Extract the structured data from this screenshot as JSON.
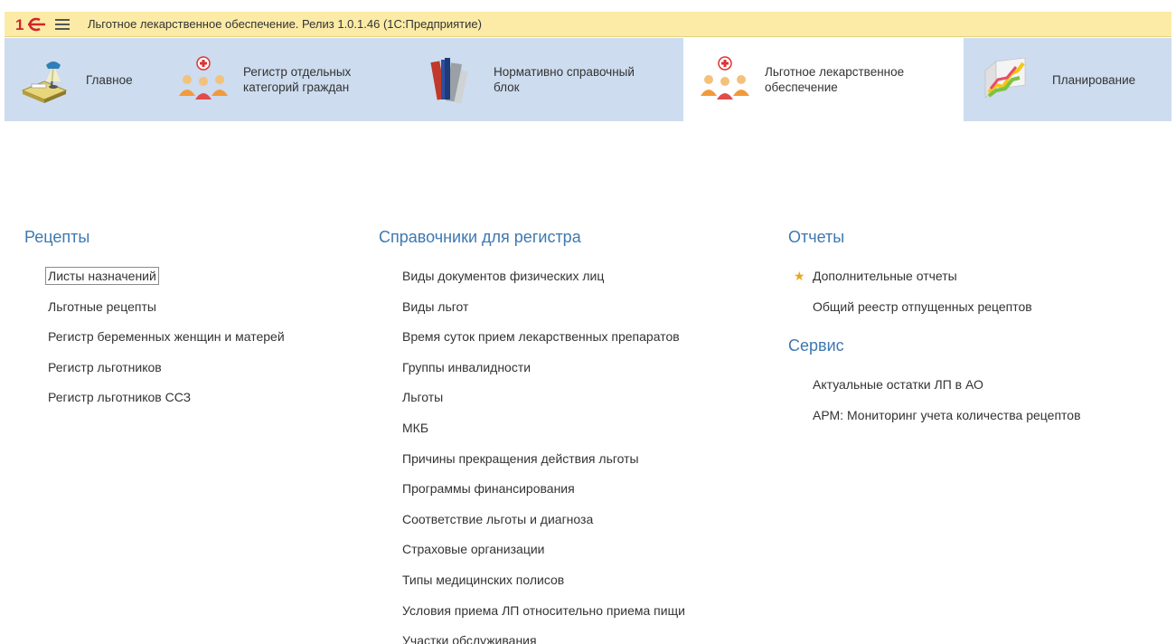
{
  "window": {
    "title": "Льготное лекарственное обеспечение. Релиз 1.0.1.46  (1С:Предприятие)",
    "logo_text": "1C",
    "menu_icon": "hamburger-icon"
  },
  "sections": [
    {
      "label_line1": "Главное",
      "label_line2": "",
      "icon": "desk-lamp-icon",
      "active": false
    },
    {
      "label_line1": "Регистр отдельных",
      "label_line2": "категорий граждан",
      "icon": "people-group-icon",
      "active": false
    },
    {
      "label_line1": "Нормативно справочный",
      "label_line2": "блок",
      "icon": "books-icon",
      "active": false
    },
    {
      "label_line1": "Льготное лекарственное",
      "label_line2": "обеспечение",
      "icon": "people-group-icon",
      "active": true
    },
    {
      "label_line1": "Планирование",
      "label_line2": "",
      "icon": "chart-icon",
      "active": false
    }
  ],
  "groups": {
    "recipes": {
      "title": "Рецепты",
      "items": [
        "Листы назначений",
        "Льготные рецепты",
        "Регистр беременных женщин и матерей",
        "Регистр льготников",
        "Регистр льготников ССЗ"
      ]
    },
    "registry_refs": {
      "title": "Справочники для регистра",
      "items": [
        "Виды документов физических лиц",
        "Виды льгот",
        "Время суток прием лекарственных препаратов",
        "Группы инвалидности",
        "Льготы",
        "МКБ",
        "Причины прекращения действия льготы",
        "Программы финансирования",
        "Соответствие льготы и диагноза",
        "Страховые организации",
        "Типы медицинских полисов",
        "Условия приема ЛП относительно приема пищи",
        "Участки обслуживания"
      ]
    },
    "reports": {
      "title": "Отчеты",
      "items": [
        "Дополнительные отчеты",
        "Общий реестр отпущенных рецептов"
      ]
    },
    "service": {
      "title": "Сервис",
      "items": [
        "Актуальные остатки ЛП в АО",
        "АРМ: Мониторинг учета количества рецептов"
      ]
    }
  },
  "colors": {
    "title_bar": "#fbeba6",
    "section_panel": "#cddcee",
    "group_title": "#3e78b0",
    "star": "#e8a81e"
  }
}
